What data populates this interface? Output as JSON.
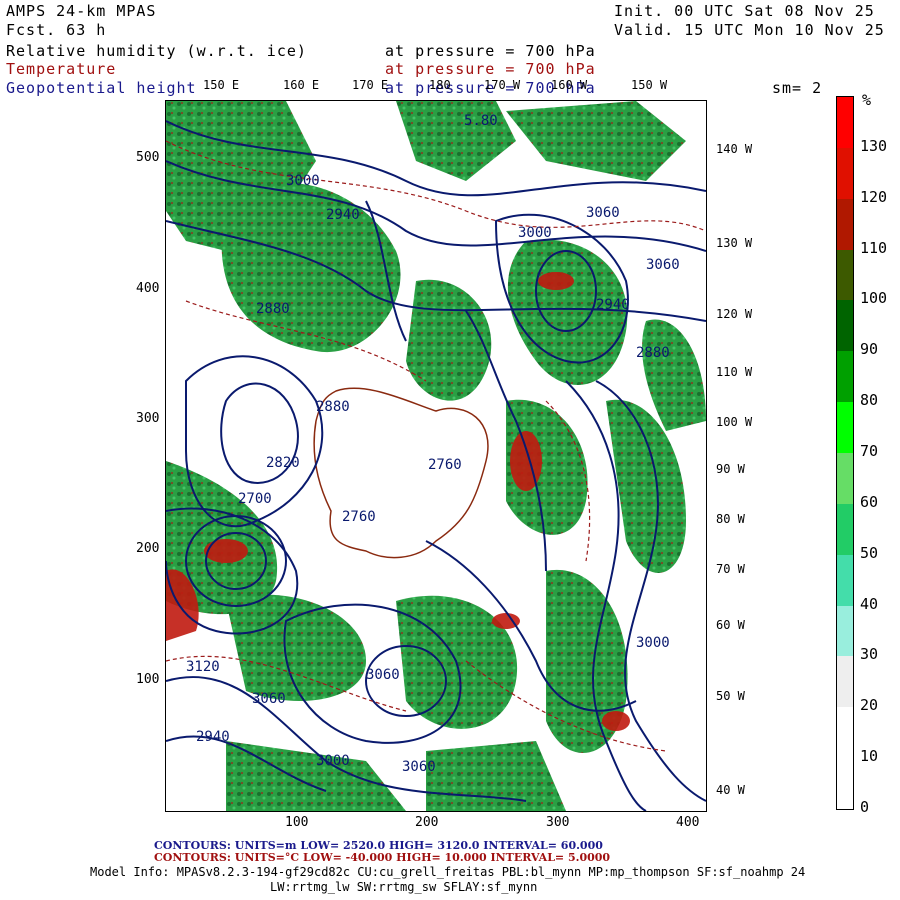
{
  "header": {
    "model": "AMPS 24-km MPAS",
    "fcst": "Fcst.    63 h",
    "init": "Init. 00 UTC Sat 08 Nov 25",
    "valid": "Valid. 15 UTC Mon 10 Nov 25",
    "field1": "Relative humidity (w.r.t. ice)",
    "field2": "Temperature",
    "field3": "Geopotential height",
    "pres1": "at pressure =  700 hPa",
    "pres2": "at pressure =  700 hPa",
    "pres3": "at pressure =  700 hPa",
    "sm": "sm= 2"
  },
  "lon_top": [
    "150 E",
    "160 E",
    "170 E",
    "180",
    "170 W",
    "160 W",
    "150 W"
  ],
  "lon_right": [
    "140 W",
    "130 W",
    "120 W",
    "110 W",
    "100 W",
    "90 W",
    "80 W",
    "70 W",
    "60 W",
    "50 W",
    "40 W"
  ],
  "y_ticks": [
    "500",
    "400",
    "300",
    "200",
    "100"
  ],
  "x_ticks": [
    "100",
    "200",
    "300",
    "400"
  ],
  "colorbar": {
    "unit": "%",
    "labels": [
      "130",
      "120",
      "110",
      "100",
      "90",
      "80",
      "70",
      "60",
      "50",
      "40",
      "30",
      "20",
      "10",
      "0"
    ],
    "colors": [
      "#ff0000",
      "#e01000",
      "#b01800",
      "#3d5a00",
      "#006400",
      "#00a000",
      "#00ff00",
      "#66dd66",
      "#22cc66",
      "#44ddaa",
      "#99eedd",
      "#eeeeee",
      "#ffffff",
      "#ffffff"
    ]
  },
  "map": {
    "height_labels": [
      "5.80",
      "3000",
      "2940",
      "3060",
      "2880",
      "2760",
      "2820",
      "2700",
      "2760",
      "3120",
      "3060",
      "2940",
      "3000",
      "3060",
      "3000",
      "2880",
      "2940",
      "3060",
      "3000",
      "2880",
      "3060"
    ],
    "ocean_color": "#ffffff",
    "moist_color": "#1f9a3a",
    "contour_color": "#0a1a6e",
    "temp_color": "#9b1b1b"
  },
  "footer": {
    "contours1": "CONTOURS:  UNITS=m  LOW=   2520.0        HIGH=  3120.0        INTERVAL=   60.000",
    "contours2": "CONTOURS:  UNITS=°C  LOW=  -40.000        HIGH=   10.000        INTERVAL=   5.0000",
    "info1": "Model Info: MPASv8.2.3-194-gf29cd82c CU:cu_grell_freitas PBL:bl_mynn MP:mp_thompson SF:sf_noahmp 24",
    "info2": "LW:rrtmg_lw SW:rrtmg_sw SFLAY:sf_mynn"
  }
}
